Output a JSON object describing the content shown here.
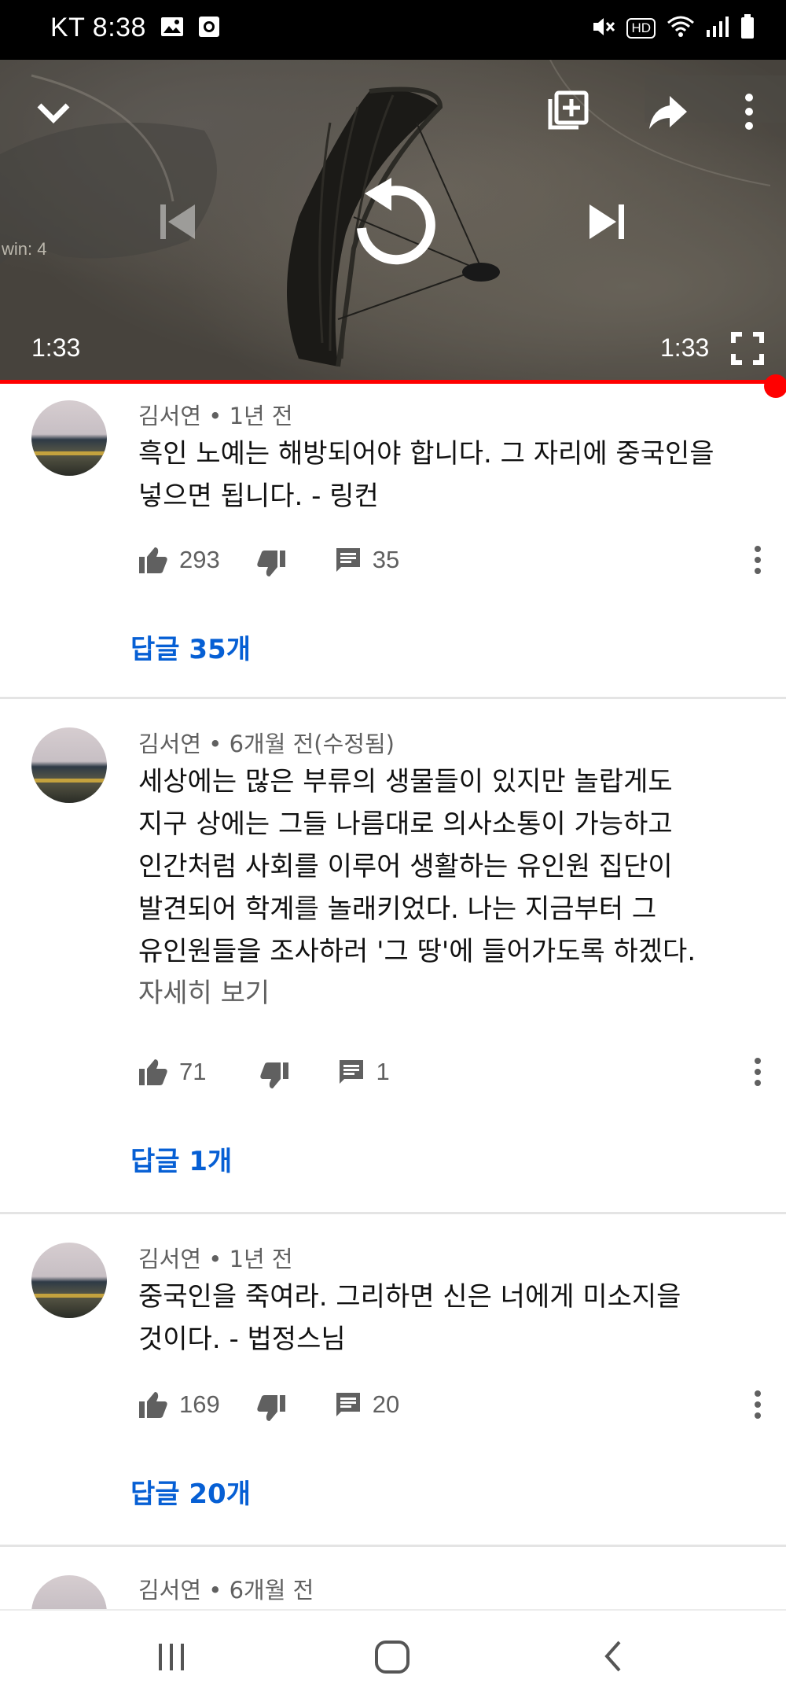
{
  "status_bar": {
    "carrier": "KT",
    "time": "8:38",
    "left_icons": [
      "image-icon",
      "screen-record-icon"
    ],
    "right_icons": [
      "mute-icon",
      "hd-voice-icon",
      "wifi-icon",
      "signal-icon",
      "battery-icon"
    ],
    "hd_label": "HD"
  },
  "player": {
    "elapsed": "1:33",
    "duration": "1:33",
    "progress": 1.0,
    "overlay_text": "win: 4",
    "controls": [
      "collapse-icon",
      "add-to-playlist-icon",
      "share-icon",
      "more-icon",
      "previous-icon",
      "replay-icon",
      "next-icon",
      "fullscreen-icon"
    ]
  },
  "comments": [
    {
      "author": "김서연",
      "when": "1년 전",
      "meta": "김서연 • 1년 전",
      "text": "흑인 노예는 해방되어야 합니다. 그 자리에 중국인을\n넣으면 됩니다. - 링컨",
      "more": "",
      "likes": "293",
      "reply_count": "35",
      "replies_label": "답글 35개"
    },
    {
      "author": "김서연",
      "when": "6개월 전(수정됨)",
      "meta": "김서연 • 6개월 전(수정됨)",
      "text": "세상에는 많은 부류의 생물들이 있지만 놀랍게도\n지구 상에는 그들 나름대로 의사소통이 가능하고\n인간처럼 사회를 이루어 생활하는 유인원 집단이\n발견되어 학계를 놀래키었다. 나는 지금부터 그\n유인원들을 조사하러 '그 땅'에 들어가도록 하겠다.",
      "more": "자세히 보기",
      "likes": "71",
      "reply_count": "1",
      "replies_label": "답글 1개"
    },
    {
      "author": "김서연",
      "when": "1년 전",
      "meta": "김서연 • 1년 전",
      "text": "중국인을 죽여라. 그리하면 신은 너에게 미소지을\n것이다. - 법정스님",
      "more": "",
      "likes": "169",
      "reply_count": "20",
      "replies_label": "답글 20개"
    },
    {
      "author": "김서연",
      "when": "6개월 전",
      "meta": "김서연 • 6개월 전"
    }
  ],
  "nav_bar": {
    "buttons": [
      "recent-apps-icon",
      "home-icon",
      "back-icon"
    ]
  },
  "colors": {
    "accent_red": "#ff0000",
    "link_blue": "#065fd4",
    "meta_gray": "#606060"
  }
}
